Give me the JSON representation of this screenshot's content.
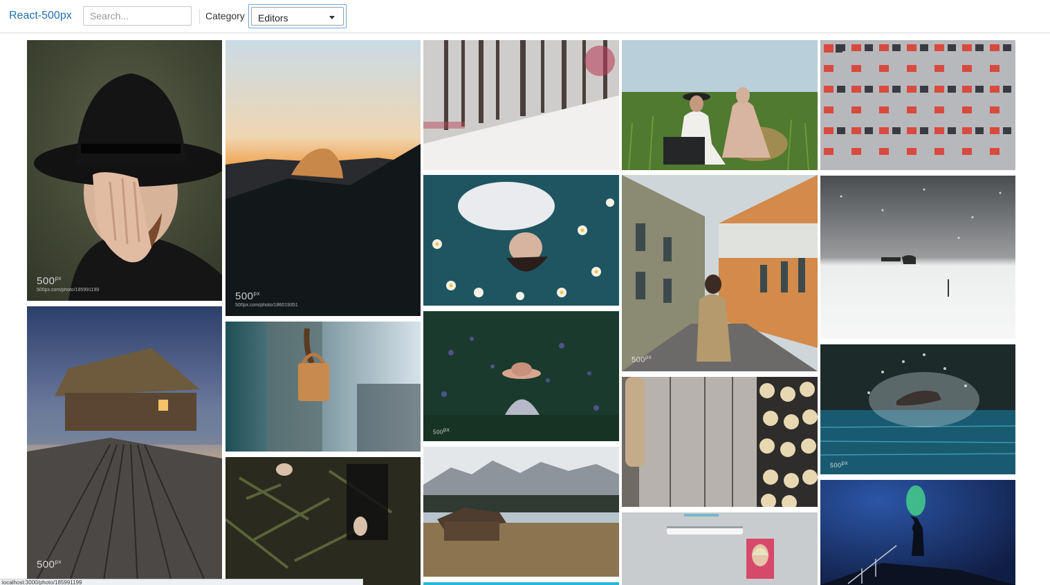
{
  "navbar": {
    "brand": "React-500px",
    "search_placeholder": "Search...",
    "search_value": "",
    "category_label": "Category",
    "category_selected": "Editors"
  },
  "watermark": {
    "logo": "500",
    "logo_sup": "px"
  },
  "photos": [
    {
      "id": "man-with-hat",
      "url": "500px.com/photo/185991199"
    },
    {
      "id": "half-dome-sunset",
      "url": "500px.com/photo/186019351"
    },
    {
      "id": "snowy-forest"
    },
    {
      "id": "couple-in-grass"
    },
    {
      "id": "apartment-facade"
    },
    {
      "id": "woman-in-water-flowers"
    },
    {
      "id": "old-street-man"
    },
    {
      "id": "snow-field-horse-sleigh"
    },
    {
      "id": "water-hut-pier"
    },
    {
      "id": "padlock-chain"
    },
    {
      "id": "girl-in-flowers-hat"
    },
    {
      "id": "rolling-pin-dumplings"
    },
    {
      "id": "swimmer-splash"
    },
    {
      "id": "hands-in-foliage"
    },
    {
      "id": "mountain-cabin-lake"
    },
    {
      "id": "wall-lamp-icon"
    },
    {
      "id": "flare-on-rooftop"
    }
  ],
  "status_bar": {
    "url": "localhost:3000/photo/185991199"
  },
  "colors": {
    "brand": "#1f6fb2",
    "select_focus": "#6aa6e0"
  }
}
